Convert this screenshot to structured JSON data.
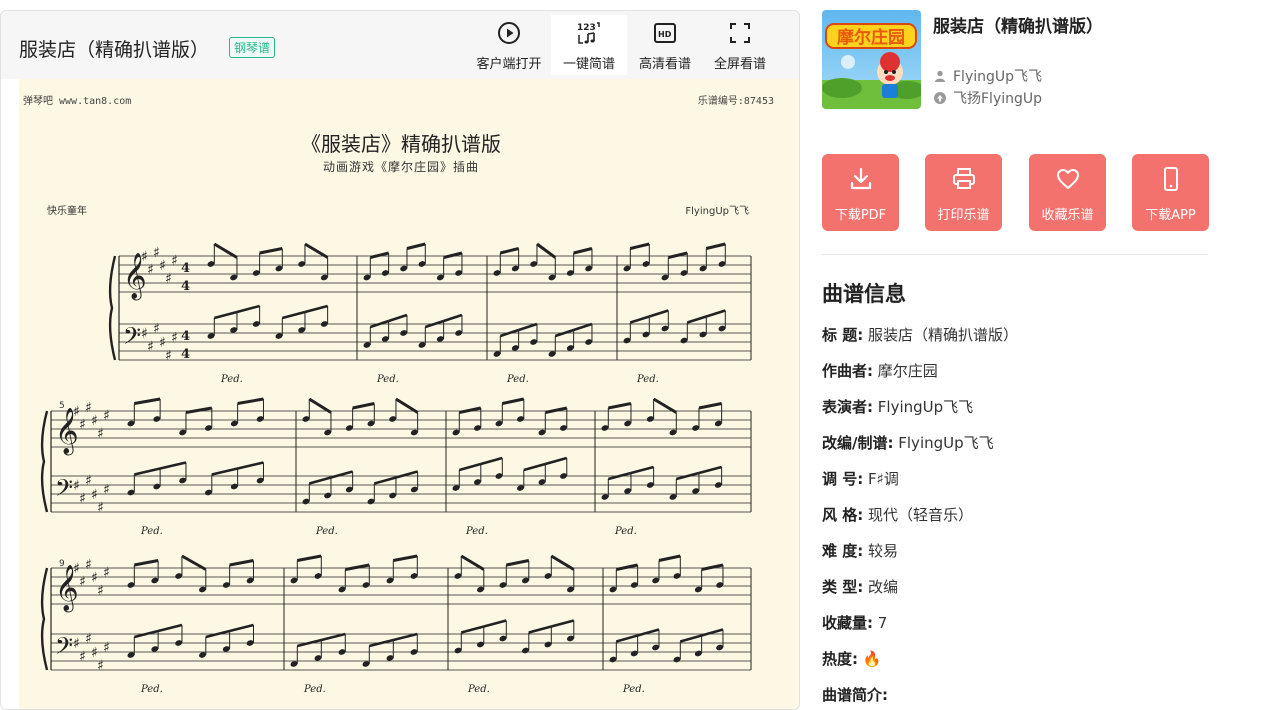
{
  "header": {
    "title": "服装店（精确扒谱版）",
    "badge": "钢琴谱",
    "tools": [
      {
        "label": "客户端打开",
        "icon": "play-circle-icon"
      },
      {
        "label": "一键简谱",
        "icon": "numbered-notation-icon"
      },
      {
        "label": "高清看谱",
        "icon": "hd-icon"
      },
      {
        "label": "全屏看谱",
        "icon": "fullscreen-icon"
      }
    ]
  },
  "sheet": {
    "site": "弹琴吧 www.tan8.com",
    "number": "乐谱编号:87453",
    "title": "《服装店》精确扒谱版",
    "subtitle": "动画游戏《摩尔庄园》插曲",
    "left_caption": "快乐童年",
    "right_caption": "FlyingUp飞飞",
    "measure_numbers": [
      "5",
      "9"
    ],
    "pedal": "Ped."
  },
  "right": {
    "title": "服装店（精确扒谱版）",
    "uploader": "FlyingUp飞飞",
    "source": "飞扬FlyingUp",
    "actions": [
      {
        "label": "下载PDF",
        "icon": "download-icon"
      },
      {
        "label": "打印乐谱",
        "icon": "printer-icon"
      },
      {
        "label": "收藏乐谱",
        "icon": "heart-icon"
      },
      {
        "label": "下载APP",
        "icon": "phone-icon"
      }
    ],
    "info_heading": "曲谱信息",
    "info": [
      {
        "k": "标 题:",
        "v": "服装店（精确扒谱版）"
      },
      {
        "k": "作曲者:",
        "v": "摩尔庄园"
      },
      {
        "k": "表演者:",
        "v": "FlyingUp飞飞"
      },
      {
        "k": "改编/制谱:",
        "v": "FlyingUp飞飞"
      },
      {
        "k": "调 号:",
        "v": "F♯调"
      },
      {
        "k": "风 格:",
        "v": "现代（轻音乐）"
      },
      {
        "k": "难 度:",
        "v": "较易"
      },
      {
        "k": "类 型:",
        "v": "改编"
      },
      {
        "k": "收藏量:",
        "v": "7"
      },
      {
        "k": "热度:",
        "v": "🔥"
      },
      {
        "k": "曲谱简介:",
        "v": ""
      }
    ]
  },
  "colors": {
    "accent": "#f4726d",
    "badge": "#2bb58f",
    "sheet_bg": "#fdf8e4"
  }
}
